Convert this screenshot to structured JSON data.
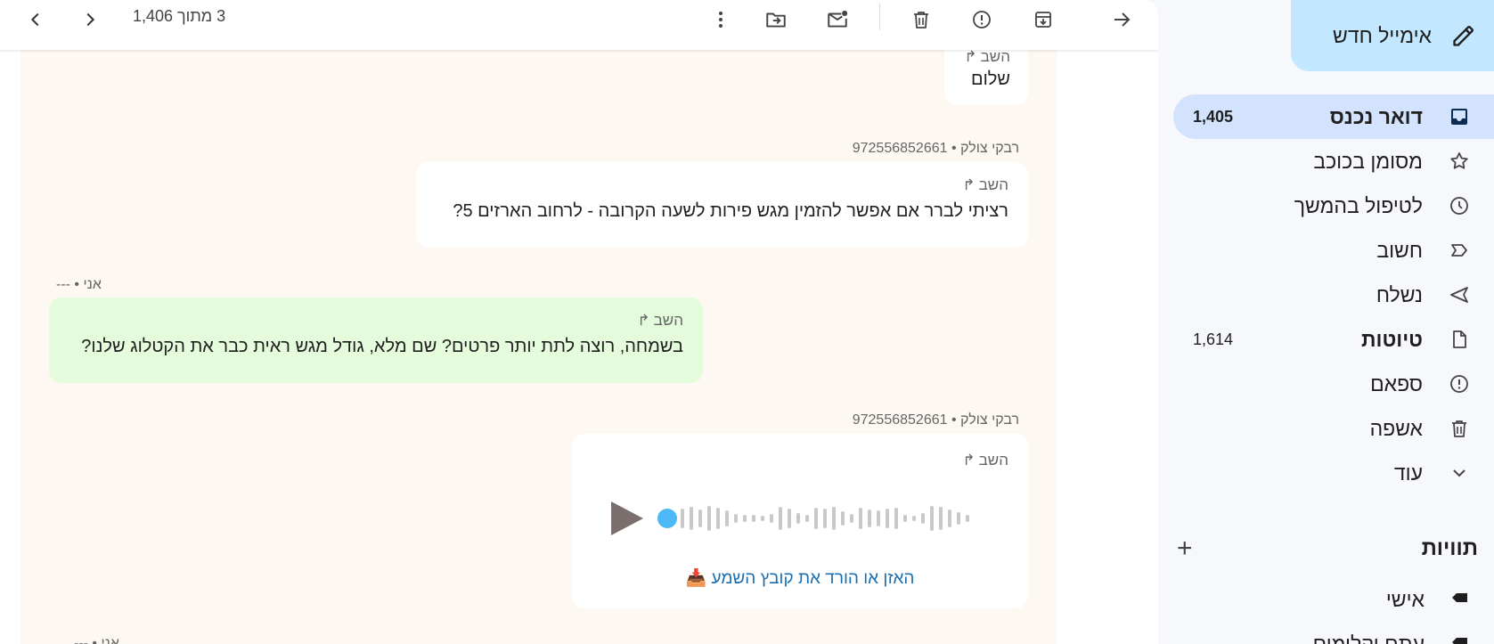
{
  "sidebar": {
    "compose_label": "אימייל חדש",
    "items": [
      {
        "label": "דואר נכנס",
        "count": "1,405",
        "icon": "inbox-icon"
      },
      {
        "label": "מסומן בכוכב",
        "count": "",
        "icon": "star-icon"
      },
      {
        "label": "לטיפול בהמשך",
        "count": "",
        "icon": "clock-icon"
      },
      {
        "label": "חשוב",
        "count": "",
        "icon": "important-icon"
      },
      {
        "label": "נשלח",
        "count": "",
        "icon": "send-icon"
      },
      {
        "label": "טיוטות",
        "count": "1,614",
        "icon": "draft-icon"
      },
      {
        "label": "ספאם",
        "count": "",
        "icon": "spam-icon"
      },
      {
        "label": "אשפה",
        "count": "",
        "icon": "trash-icon"
      },
      {
        "label": "עוד",
        "count": "",
        "icon": "chevron-down-icon"
      }
    ],
    "labels_title": "תוויות",
    "labels": [
      {
        "label": "אישי"
      },
      {
        "label": "עתם וקלימים"
      }
    ]
  },
  "toolbar": {
    "pager_text": "3 מתוך 1,406"
  },
  "messages": [
    {
      "reply": "השב",
      "text": "שלום"
    },
    {
      "meta": "רבקי צולק • 972556852661",
      "reply": "השב",
      "text": "רציתי לברר אם אפשר להזמין מגש פירות לשעה הקרובה - לרחוב הארזים 5?"
    },
    {
      "meta": "אני • ---",
      "reply": "השב",
      "text": "בשמחה, רוצה לתת יותר פרטים? שם מלא, גודל מגש ראית כבר את הקטלוג שלנו?"
    },
    {
      "meta": "רבקי צולק • 972556852661",
      "reply": "השב",
      "audio_link": "📥 האזן או הורד את קובץ השמע",
      "audio_progress": 0
    },
    {
      "meta": "אני • ---"
    }
  ],
  "colors": {
    "compose_bg": "#c2e7ff",
    "active_nav_bg": "#d3e3fd",
    "conversation_bg": "#fdf8f2",
    "my_bubble_bg": "#e4fbdc",
    "audio_dot": "#4cb8f5"
  }
}
